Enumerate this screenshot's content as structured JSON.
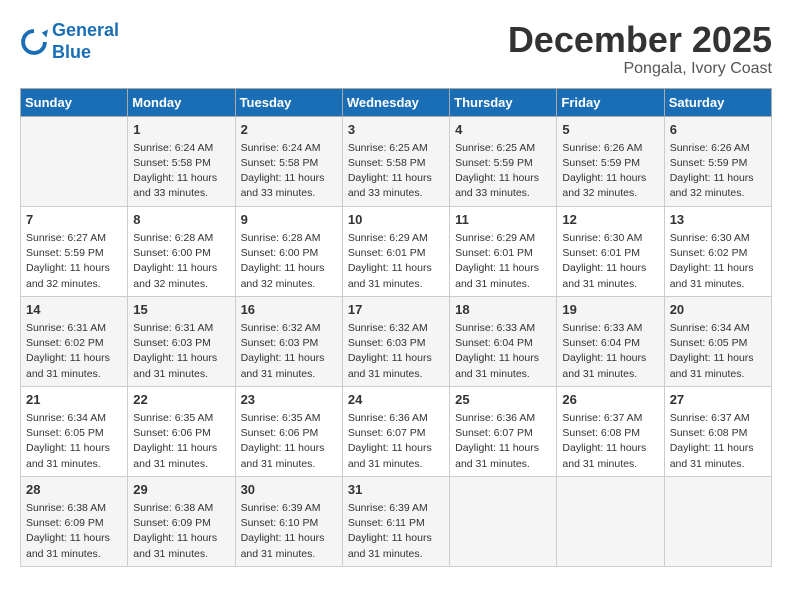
{
  "header": {
    "logo_line1": "General",
    "logo_line2": "Blue",
    "title": "December 2025",
    "location": "Pongala, Ivory Coast"
  },
  "days_of_week": [
    "Sunday",
    "Monday",
    "Tuesday",
    "Wednesday",
    "Thursday",
    "Friday",
    "Saturday"
  ],
  "weeks": [
    [
      {
        "day": "",
        "info": ""
      },
      {
        "day": "1",
        "info": "Sunrise: 6:24 AM\nSunset: 5:58 PM\nDaylight: 11 hours\nand 33 minutes."
      },
      {
        "day": "2",
        "info": "Sunrise: 6:24 AM\nSunset: 5:58 PM\nDaylight: 11 hours\nand 33 minutes."
      },
      {
        "day": "3",
        "info": "Sunrise: 6:25 AM\nSunset: 5:58 PM\nDaylight: 11 hours\nand 33 minutes."
      },
      {
        "day": "4",
        "info": "Sunrise: 6:25 AM\nSunset: 5:59 PM\nDaylight: 11 hours\nand 33 minutes."
      },
      {
        "day": "5",
        "info": "Sunrise: 6:26 AM\nSunset: 5:59 PM\nDaylight: 11 hours\nand 32 minutes."
      },
      {
        "day": "6",
        "info": "Sunrise: 6:26 AM\nSunset: 5:59 PM\nDaylight: 11 hours\nand 32 minutes."
      }
    ],
    [
      {
        "day": "7",
        "info": "Sunrise: 6:27 AM\nSunset: 5:59 PM\nDaylight: 11 hours\nand 32 minutes."
      },
      {
        "day": "8",
        "info": "Sunrise: 6:28 AM\nSunset: 6:00 PM\nDaylight: 11 hours\nand 32 minutes."
      },
      {
        "day": "9",
        "info": "Sunrise: 6:28 AM\nSunset: 6:00 PM\nDaylight: 11 hours\nand 32 minutes."
      },
      {
        "day": "10",
        "info": "Sunrise: 6:29 AM\nSunset: 6:01 PM\nDaylight: 11 hours\nand 31 minutes."
      },
      {
        "day": "11",
        "info": "Sunrise: 6:29 AM\nSunset: 6:01 PM\nDaylight: 11 hours\nand 31 minutes."
      },
      {
        "day": "12",
        "info": "Sunrise: 6:30 AM\nSunset: 6:01 PM\nDaylight: 11 hours\nand 31 minutes."
      },
      {
        "day": "13",
        "info": "Sunrise: 6:30 AM\nSunset: 6:02 PM\nDaylight: 11 hours\nand 31 minutes."
      }
    ],
    [
      {
        "day": "14",
        "info": "Sunrise: 6:31 AM\nSunset: 6:02 PM\nDaylight: 11 hours\nand 31 minutes."
      },
      {
        "day": "15",
        "info": "Sunrise: 6:31 AM\nSunset: 6:03 PM\nDaylight: 11 hours\nand 31 minutes."
      },
      {
        "day": "16",
        "info": "Sunrise: 6:32 AM\nSunset: 6:03 PM\nDaylight: 11 hours\nand 31 minutes."
      },
      {
        "day": "17",
        "info": "Sunrise: 6:32 AM\nSunset: 6:03 PM\nDaylight: 11 hours\nand 31 minutes."
      },
      {
        "day": "18",
        "info": "Sunrise: 6:33 AM\nSunset: 6:04 PM\nDaylight: 11 hours\nand 31 minutes."
      },
      {
        "day": "19",
        "info": "Sunrise: 6:33 AM\nSunset: 6:04 PM\nDaylight: 11 hours\nand 31 minutes."
      },
      {
        "day": "20",
        "info": "Sunrise: 6:34 AM\nSunset: 6:05 PM\nDaylight: 11 hours\nand 31 minutes."
      }
    ],
    [
      {
        "day": "21",
        "info": "Sunrise: 6:34 AM\nSunset: 6:05 PM\nDaylight: 11 hours\nand 31 minutes."
      },
      {
        "day": "22",
        "info": "Sunrise: 6:35 AM\nSunset: 6:06 PM\nDaylight: 11 hours\nand 31 minutes."
      },
      {
        "day": "23",
        "info": "Sunrise: 6:35 AM\nSunset: 6:06 PM\nDaylight: 11 hours\nand 31 minutes."
      },
      {
        "day": "24",
        "info": "Sunrise: 6:36 AM\nSunset: 6:07 PM\nDaylight: 11 hours\nand 31 minutes."
      },
      {
        "day": "25",
        "info": "Sunrise: 6:36 AM\nSunset: 6:07 PM\nDaylight: 11 hours\nand 31 minutes."
      },
      {
        "day": "26",
        "info": "Sunrise: 6:37 AM\nSunset: 6:08 PM\nDaylight: 11 hours\nand 31 minutes."
      },
      {
        "day": "27",
        "info": "Sunrise: 6:37 AM\nSunset: 6:08 PM\nDaylight: 11 hours\nand 31 minutes."
      }
    ],
    [
      {
        "day": "28",
        "info": "Sunrise: 6:38 AM\nSunset: 6:09 PM\nDaylight: 11 hours\nand 31 minutes."
      },
      {
        "day": "29",
        "info": "Sunrise: 6:38 AM\nSunset: 6:09 PM\nDaylight: 11 hours\nand 31 minutes."
      },
      {
        "day": "30",
        "info": "Sunrise: 6:39 AM\nSunset: 6:10 PM\nDaylight: 11 hours\nand 31 minutes."
      },
      {
        "day": "31",
        "info": "Sunrise: 6:39 AM\nSunset: 6:11 PM\nDaylight: 11 hours\nand 31 minutes."
      },
      {
        "day": "",
        "info": ""
      },
      {
        "day": "",
        "info": ""
      },
      {
        "day": "",
        "info": ""
      }
    ]
  ]
}
